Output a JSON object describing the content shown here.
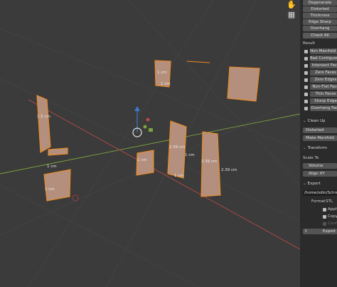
{
  "panel": {
    "checks_top": [
      "Degenerate",
      "Distorted",
      "Thickness",
      "Edge Sharp",
      "Overhang"
    ],
    "thickness_value": "0",
    "check_all": "Check All",
    "result_label": "Result",
    "result_items": [
      {
        "label": "Non Manifold Ed",
        "icon": "info-icon"
      },
      {
        "label": "Bad Contiguous E",
        "icon": "info-icon"
      },
      {
        "label": "Intersect Face",
        "icon": "checkbox-icon"
      },
      {
        "label": "Zero Faces",
        "icon": "info-icon"
      },
      {
        "label": "Zero Edges",
        "icon": "info-icon"
      },
      {
        "label": "Non-Flat Face",
        "icon": "checkbox-icon"
      },
      {
        "label": "Thin Faces",
        "icon": "info-icon"
      },
      {
        "label": "Sharp Edge",
        "icon": "info-icon"
      },
      {
        "label": "Overhang Face",
        "icon": "checkbox-icon"
      }
    ],
    "cleanup": {
      "title": "Clean Up",
      "distorted": "Distorted",
      "make_manifold": "Make Manifold"
    },
    "transform": {
      "title": "Transform",
      "scale_to": "Scale To",
      "volume": "Volume",
      "align_xy": "Align XY"
    },
    "export": {
      "title": "Export",
      "path": "/home/sdin/Schreibtisch",
      "format_label": "Format",
      "format_value": "STL",
      "opt1": "Apply",
      "opt2": "Copy",
      "opt3": "Conf",
      "button": "Export"
    }
  },
  "viewport": {
    "labels": [
      "1 cm",
      "1 cm",
      "1.5 cm",
      "1 cm",
      "2.39 cm",
      "2.39 cm",
      "1 cm",
      "1 cm",
      "2.39 cm",
      "1 cm",
      "1 cm"
    ],
    "icons": [
      "grab-icon",
      "orthographic-grid-icon"
    ]
  },
  "colors": {
    "face": "#b48f7d",
    "edge": "#f08c1e",
    "x_axis": "#b84a4a",
    "y_axis": "#7ca23c",
    "z_axis": "#3d78c8"
  }
}
